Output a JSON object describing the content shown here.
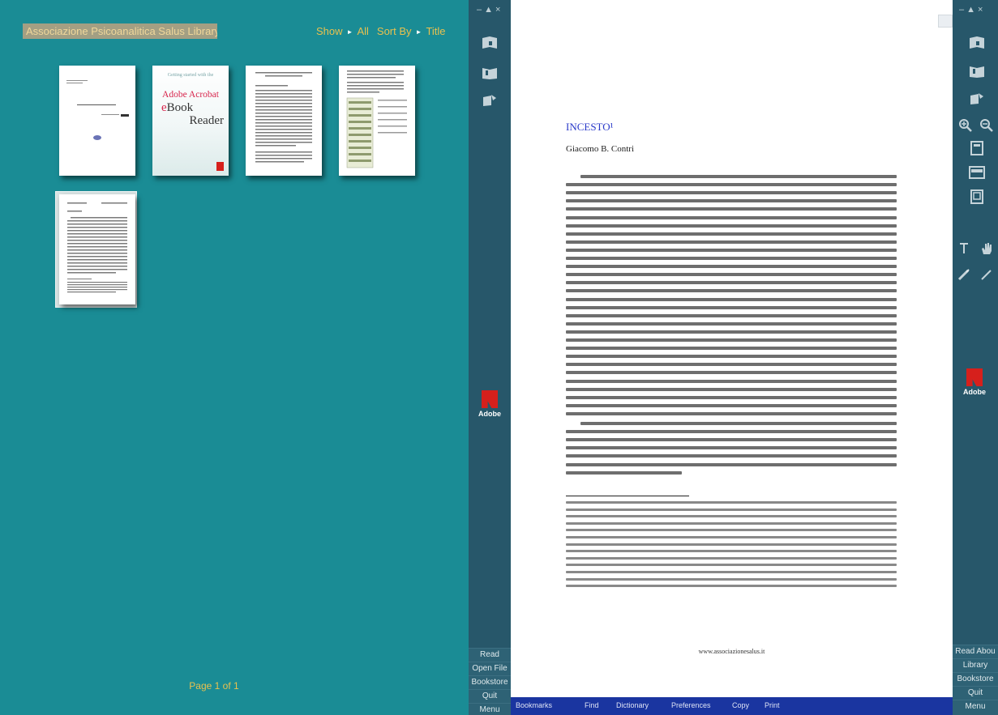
{
  "library": {
    "title": "Associazione Psicoanalitica Salus Library",
    "show_label": "Show",
    "show_value": "All",
    "sort_label": "Sort By",
    "sort_value": "Title",
    "arrow": "►",
    "page_indicator": "Page 1 of 1",
    "books": [
      {
        "name": "book-1"
      },
      {
        "name": "book-adobe-reader",
        "getting_started": "Getting started with the",
        "acrobat": "Adobe Acrobat",
        "ebook_e": "e",
        "ebook_rest": "Book",
        "reader": "Reader"
      },
      {
        "name": "book-3"
      },
      {
        "name": "book-4"
      },
      {
        "name": "book-5"
      }
    ]
  },
  "left_panel": {
    "window_controls": "–▲×",
    "adobe_label": "Adobe",
    "buttons": [
      "Read",
      "Open File",
      "Bookstore",
      "Quit",
      "Menu"
    ]
  },
  "right_panel": {
    "window_controls": "–▲×",
    "adobe_label": "Adobe",
    "buttons": [
      "Read Abou",
      "Library",
      "Bookstore",
      "Quit",
      "Menu"
    ]
  },
  "document": {
    "title": "INCESTO¹",
    "author": "Giacomo B. Contri",
    "footer": "www.associazionesalus.it"
  },
  "toolbar": {
    "items": [
      "Bookmarks",
      "Find",
      "Dictionary",
      "Preferences",
      "Copy",
      "Print"
    ]
  },
  "colors": {
    "library_bg": "#1a8c95",
    "panel_bg": "#27576a",
    "toolbar_bg": "#1a35a0",
    "accent_gold": "#e9c14e",
    "title_blue": "#2939c9",
    "adobe_red": "#d6201c"
  }
}
